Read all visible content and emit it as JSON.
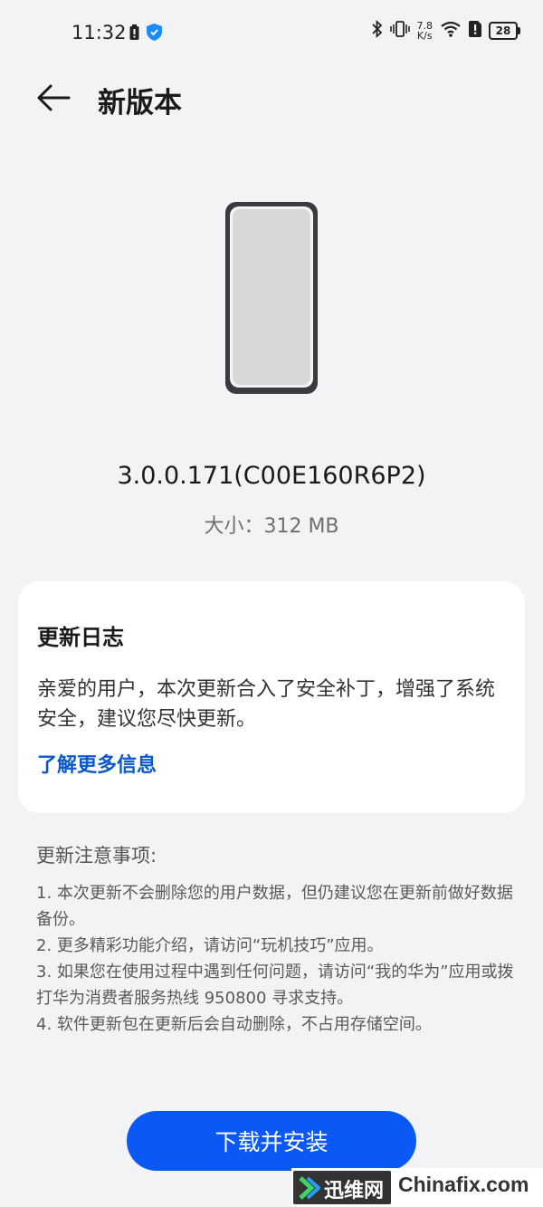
{
  "status_bar": {
    "time": "11:32",
    "net_speed_value": "7.8",
    "net_speed_unit": "K/s",
    "battery_level": "28"
  },
  "header": {
    "title": "新版本",
    "back_icon": "arrow-left-icon"
  },
  "update": {
    "version": "3.0.0.171(C00E160R6P2)",
    "size": "大小：312 MB"
  },
  "changelog": {
    "title": "更新日志",
    "body": "亲爱的用户，本次更新合入了安全补丁，增强了系统安全，建议您尽快更新。",
    "link": "了解更多信息"
  },
  "notes": {
    "heading": "更新注意事项:",
    "items": [
      "1. 本次更新不会删除您的用户数据，但仍建议您在更新前做好数据备份。",
      "2. 更多精彩功能介绍，请访问“玩机技巧”应用。",
      "3. 如果您在使用过程中遇到任何问题，请访问“我的华为”应用或拨打华为消费者服务热线 950800 寻求支持。",
      "4. 软件更新包在更新后会自动删除，不占用存储空间。"
    ]
  },
  "actions": {
    "install_label": "下载并安装"
  },
  "watermark": {
    "cn": "迅维网",
    "en": "Chinafix.com"
  },
  "colors": {
    "accent": "#0a59f7",
    "link": "#0a59c7",
    "background": "#f1f3f5"
  }
}
